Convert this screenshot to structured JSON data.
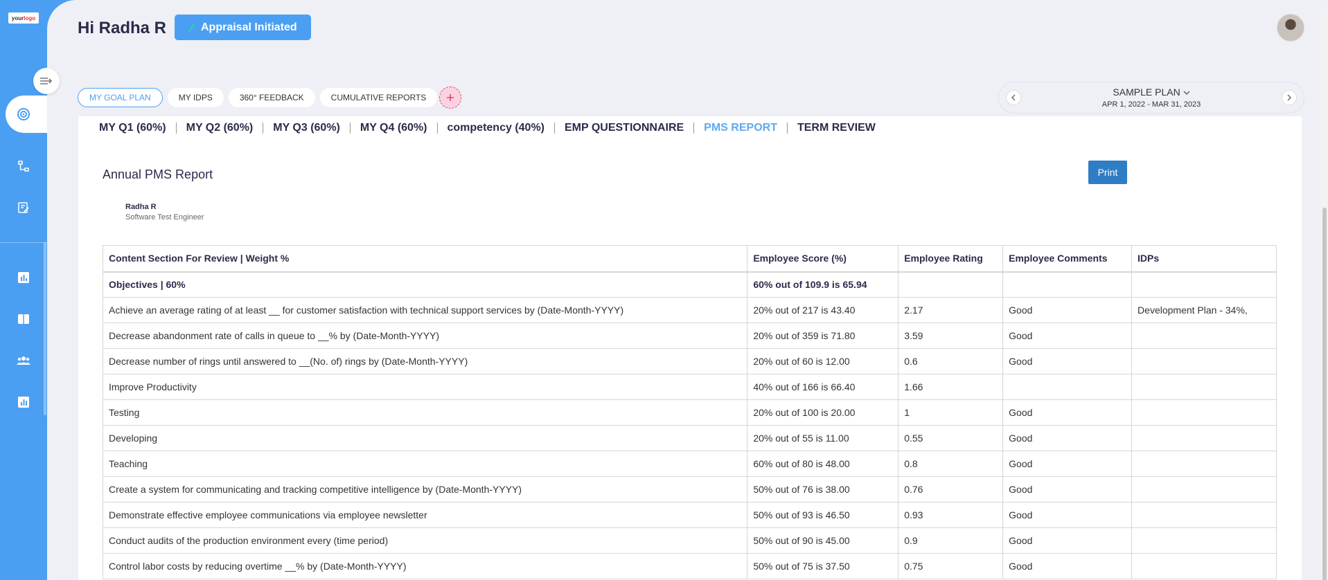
{
  "sidebar": {
    "logo_text": "your",
    "logo_accent": "logo",
    "icons": [
      "collapse-arrow-icon",
      "goal-target-icon",
      "org-tree-icon",
      "document-edit-icon",
      "bar-chart-icon",
      "book-icon",
      "team-icon",
      "report-chart-icon"
    ]
  },
  "header": {
    "greeting": "Hi Radha R",
    "status": "Appraisal Initiated"
  },
  "tabs": [
    "MY GOAL PLAN",
    "MY IDPS",
    "360° FEEDBACK",
    "CUMULATIVE REPORTS"
  ],
  "plan": {
    "name": "SAMPLE PLAN",
    "dates": "APR 1, 2022 - MAR 31, 2023"
  },
  "subtabs": [
    "MY Q1 (60%)",
    "MY Q2 (60%)",
    "MY Q3 (60%)",
    "MY Q4 (60%)",
    "competency (40%)",
    "EMP QUESTIONNAIRE",
    "PMS REPORT",
    "TERM REVIEW"
  ],
  "report": {
    "title": "Annual PMS Report",
    "print_label": "Print",
    "employee_name": "Radha R",
    "employee_role": "Software Test Engineer"
  },
  "table": {
    "headers": [
      "Content Section For Review | Weight %",
      "Employee Score (%)",
      "Employee Rating",
      "Employee Comments",
      "IDPs"
    ],
    "rows": [
      [
        "Objectives | 60%",
        "60% out of 109.9 is 65.94",
        "",
        "",
        ""
      ],
      [
        "Achieve an average rating of at least __ for customer satisfaction with technical support services by (Date-Month-YYYY)",
        "20% out of 217 is 43.40",
        "2.17",
        "Good",
        "Development Plan - 34%,"
      ],
      [
        "Decrease abandonment rate of calls in queue to __% by (Date-Month-YYYY)",
        "20% out of 359 is 71.80",
        "3.59",
        "Good",
        ""
      ],
      [
        "Decrease number of rings until answered to __(No. of) rings by (Date-Month-YYYY)",
        "20% out of 60 is 12.00",
        "0.6",
        "Good",
        ""
      ],
      [
        "Improve Productivity",
        "40% out of 166 is 66.40",
        "1.66",
        "",
        ""
      ],
      [
        "Testing",
        "20% out of 100 is 20.00",
        "1",
        "Good",
        ""
      ],
      [
        "Developing",
        "20% out of 55 is 11.00",
        "0.55",
        "Good",
        ""
      ],
      [
        "Teaching",
        "60% out of 80 is 48.00",
        "0.8",
        "Good",
        ""
      ],
      [
        "Create a system for communicating and tracking competitive intelligence by (Date-Month-YYYY)",
        "50% out of 76 is 38.00",
        "0.76",
        "Good",
        ""
      ],
      [
        "Demonstrate effective employee communications via employee newsletter",
        "50% out of 93 is 46.50",
        "0.93",
        "Good",
        ""
      ],
      [
        "Conduct audits of the production environment every (time period)",
        "50% out of 90 is 45.00",
        "0.9",
        "Good",
        ""
      ],
      [
        "Control labor costs by reducing overtime __% by (Date-Month-YYYY)",
        "50% out of 75 is 37.50",
        "0.75",
        "Good",
        ""
      ]
    ]
  },
  "colors": {
    "accent": "#4b9ff2",
    "print": "#2f7dc4",
    "active_subtab": "#5fa9f0"
  }
}
